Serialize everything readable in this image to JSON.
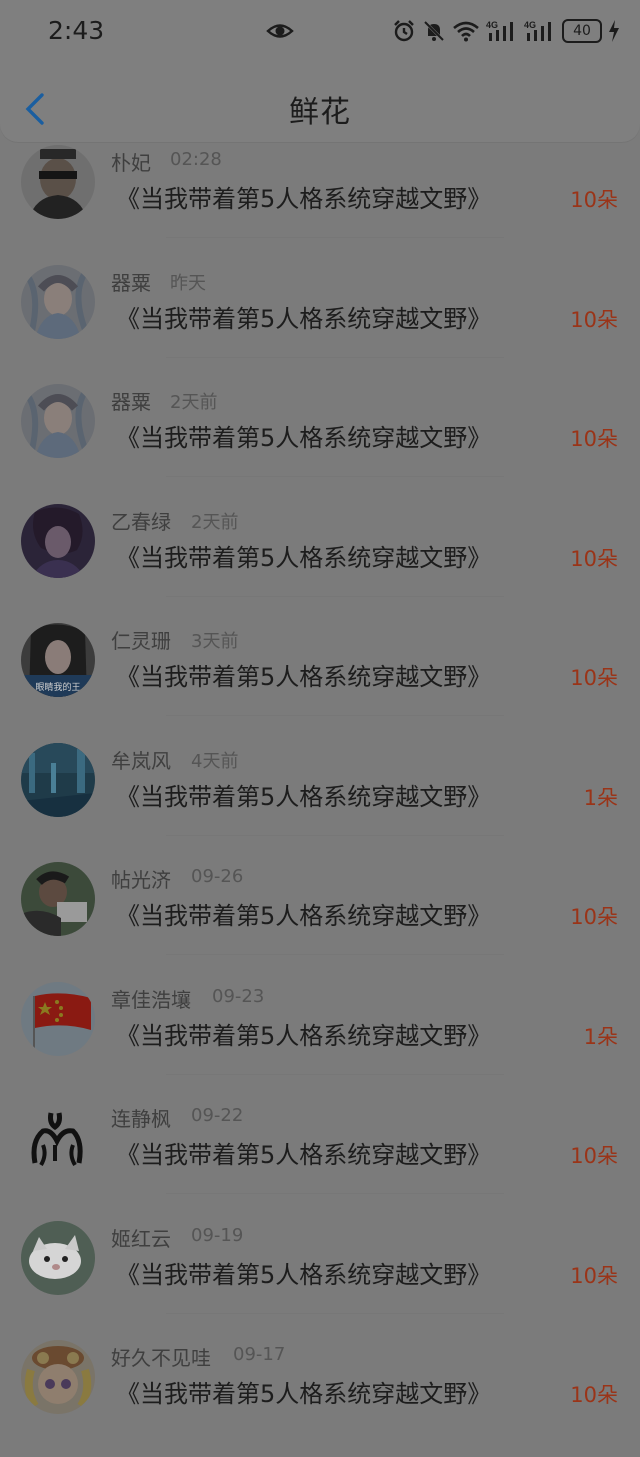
{
  "status_bar": {
    "time": "2:43",
    "battery": "40",
    "icons": [
      "eye-icon",
      "alarm-icon",
      "mute-icon",
      "wifi-icon",
      "4g-signal-icon",
      "4g-signal-icon",
      "battery-icon",
      "charging-icon"
    ]
  },
  "header": {
    "title": "鲜花",
    "back_icon": "chevron-left-icon",
    "back_color": "#1a5ea0"
  },
  "items": [
    {
      "name": "朴妃",
      "date": "02:28",
      "book": "《当我带着第5人格系统穿越文野》",
      "count": "10朵"
    },
    {
      "name": "器粟",
      "date": "昨天",
      "book": "《当我带着第5人格系统穿越文野》",
      "count": "10朵"
    },
    {
      "name": "器粟",
      "date": "2天前",
      "book": "《当我带着第5人格系统穿越文野》",
      "count": "10朵"
    },
    {
      "name": "乙春绿",
      "date": "2天前",
      "book": "《当我带着第5人格系统穿越文野》",
      "count": "10朵"
    },
    {
      "name": "仁灵珊",
      "date": "3天前",
      "book": "《当我带着第5人格系统穿越文野》",
      "count": "10朵"
    },
    {
      "name": "牟岚风",
      "date": "4天前",
      "book": "《当我带着第5人格系统穿越文野》",
      "count": "1朵"
    },
    {
      "name": "帖光济",
      "date": "09-26",
      "book": "《当我带着第5人格系统穿越文野》",
      "count": "10朵"
    },
    {
      "name": "章佳浩壤",
      "date": "09-23",
      "book": "《当我带着第5人格系统穿越文野》",
      "count": "1朵"
    },
    {
      "name": "连静枫",
      "date": "09-22",
      "book": "《当我带着第5人格系统穿越文野》",
      "count": "10朵"
    },
    {
      "name": "姬红云",
      "date": "09-19",
      "book": "《当我带着第5人格系统穿越文野》",
      "count": "10朵"
    },
    {
      "name": "好久不见哇",
      "date": "09-17",
      "book": "《当我带着第5人格系统穿越文野》",
      "count": "10朵"
    }
  ],
  "avatar_text_item5": "眼睛我的王"
}
